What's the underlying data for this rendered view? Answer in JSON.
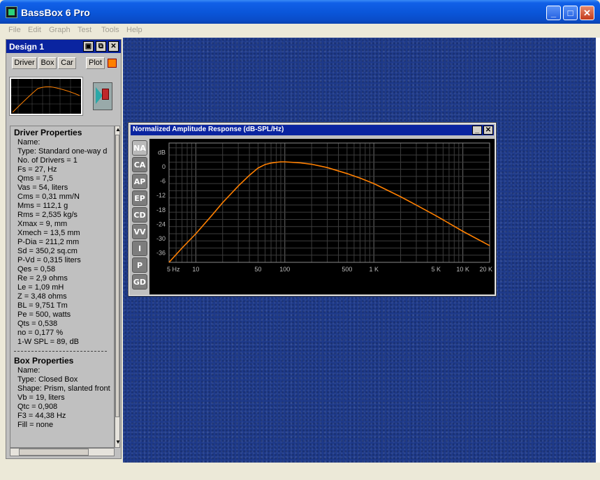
{
  "window": {
    "title": "BassBox 6 Pro",
    "minimize": "_",
    "maximize": "□",
    "close": "✕"
  },
  "menu": [
    "File",
    "Edit",
    "Graph",
    "Test",
    "Tools",
    "Help"
  ],
  "design_panel": {
    "title": "Design 1",
    "buttons": [
      "Driver",
      "Box",
      "Car",
      "Plot"
    ],
    "plot_color": "#ff8000"
  },
  "driver_properties": {
    "heading": "Driver Properties",
    "lines": [
      "Name:",
      "Type: Standard one-way d",
      "No. of Drivers = 1",
      "Fs = 27, Hz",
      "Qms = 7,5",
      "Vas = 54, liters",
      "Cms = 0,31 mm/N",
      "Mms = 112,1 g",
      "Rms = 2,535 kg/s",
      "Xmax = 9, mm",
      "Xmech = 13,5 mm",
      "P-Dia = 211,2 mm",
      "Sd = 350,2 sq.cm",
      "P-Vd = 0,315 liters",
      "Qes = 0,58",
      "Re = 2,9 ohms",
      "Le = 1,09 mH",
      "Z = 3,48 ohms",
      "BL = 9,751 Tm",
      "Pe = 500, watts",
      "Qts = 0,538",
      "no = 0,177 %",
      "1-W SPL = 89, dB"
    ]
  },
  "box_properties": {
    "heading": "Box Properties",
    "lines": [
      "Name:",
      "Type: Closed Box",
      "Shape: Prism, slanted front",
      "Vb = 19, liters",
      "Qtc = 0,908",
      "F3 = 44,38 Hz",
      "Fill = none"
    ]
  },
  "graph_window": {
    "title": "Normalized Amplitude Response (dB-SPL/Hz)",
    "tabs": [
      "NA",
      "CA",
      "AP",
      "EP",
      "CD",
      "VV",
      "I",
      "P",
      "GD"
    ],
    "active_tab": "NA"
  },
  "chart_data": {
    "type": "line",
    "title": "Normalized Amplitude Response (dB-SPL/Hz)",
    "xlabel": "",
    "ylabel": "dB",
    "x_scale": "log",
    "xlim": [
      5,
      20000
    ],
    "ylim": [
      -40,
      10
    ],
    "x_ticks": [
      {
        "v": 5,
        "label": "5 Hz"
      },
      {
        "v": 10,
        "label": "10"
      },
      {
        "v": 50,
        "label": "50"
      },
      {
        "v": 100,
        "label": "100"
      },
      {
        "v": 500,
        "label": "500"
      },
      {
        "v": 1000,
        "label": "1 K"
      },
      {
        "v": 5000,
        "label": "5 K"
      },
      {
        "v": 10000,
        "label": "10 K"
      },
      {
        "v": 20000,
        "label": "20 K"
      }
    ],
    "y_ticks": [
      {
        "v": 6,
        "label": "dB"
      },
      {
        "v": 0,
        "label": "0"
      },
      {
        "v": -6,
        "label": "-6"
      },
      {
        "v": -12,
        "label": "-12"
      },
      {
        "v": -18,
        "label": "-18"
      },
      {
        "v": -24,
        "label": "-24"
      },
      {
        "v": -30,
        "label": "-30"
      },
      {
        "v": -36,
        "label": "-36"
      }
    ],
    "grid": true,
    "series": [
      {
        "color": "#ff8000",
        "x": [
          5,
          7,
          10,
          15,
          20,
          30,
          40,
          50,
          60,
          70,
          80,
          90,
          100,
          150,
          200,
          300,
          500,
          700,
          1000,
          2000,
          3000,
          5000,
          10000,
          20000
        ],
        "y": [
          -40,
          -34,
          -28,
          -20.5,
          -15,
          -8,
          -3.5,
          -0.5,
          1,
          1.6,
          1.9,
          2.1,
          2.1,
          1.7,
          1.1,
          -0.3,
          -2.8,
          -4.7,
          -7,
          -12.5,
          -16,
          -20.5,
          -27,
          -33
        ]
      }
    ]
  }
}
